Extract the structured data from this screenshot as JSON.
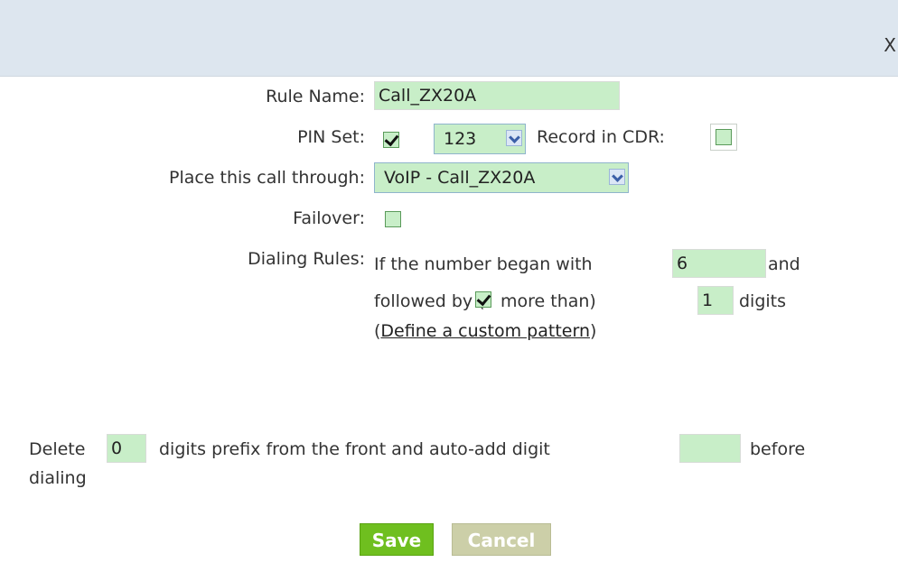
{
  "dialog": {
    "close_label": "X"
  },
  "form": {
    "rule_name_label": "Rule Name:",
    "rule_name_value": "Call_ZX20A",
    "pin_set_label": "PIN Set:",
    "pin_set_checked": true,
    "pin_set_selected": "123",
    "record_cdr_label": "Record in CDR:",
    "record_cdr_checked": false,
    "place_call_label": "Place this call through:",
    "place_call_selected": "VoIP - Call_ZX20A",
    "failover_label": "Failover:",
    "failover_checked": false,
    "dialing_rules_label": "Dialing Rules:",
    "dialing_text_1": "If the number began with",
    "began_with_value": "6",
    "dialing_text_and": "and",
    "followed_by_text": "followed by (",
    "more_than_checked": true,
    "more_than_text": "more than)",
    "digits_count_value": "1",
    "digits_text": "digits",
    "custom_pattern_open": "(",
    "custom_pattern_link": "Define a custom pattern",
    "custom_pattern_close": ")",
    "delete_text": "Delete",
    "delete_digits_value": "0",
    "prefix_text": "digits prefix from the front and auto-add digit",
    "auto_add_value": "",
    "before_text": "before",
    "dialing_text": "dialing"
  },
  "buttons": {
    "save_label": "Save",
    "cancel_label": "Cancel"
  },
  "colors": {
    "header_bg": "#dde6ef",
    "field_bg": "#c8eec8",
    "save_bg": "#6fbf1f",
    "cancel_bg": "#cccfa8"
  }
}
